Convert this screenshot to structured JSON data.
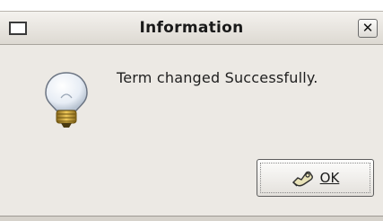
{
  "window": {
    "title": "Information",
    "close_glyph": "✕",
    "icon": "window-icon"
  },
  "dialog": {
    "icon": "lightbulb-icon",
    "message": "Term changed Successfully."
  },
  "buttons": {
    "ok": {
      "label": "OK",
      "icon": "ok-hand-icon"
    }
  }
}
